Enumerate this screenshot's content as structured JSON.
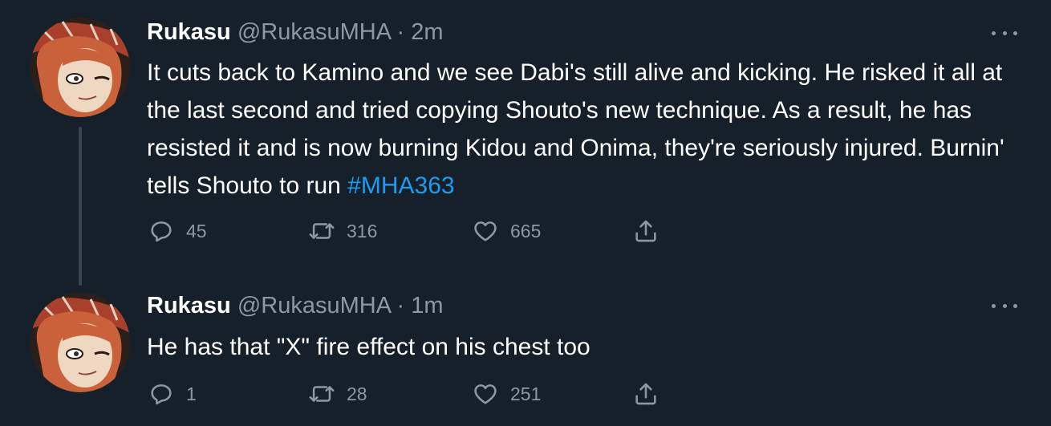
{
  "tweets": [
    {
      "display_name": "Rukasu",
      "handle": "@RukasuMHA",
      "separator": "·",
      "time": "2m",
      "text": "It cuts back to Kamino and we see Dabi's still alive and kicking. He risked it all at the last second and tried copying Shouto's new technique. As a result, he has resisted it and is now burning Kidou and Onima, they're seriously injured. Burnin' tells Shouto to run ",
      "hashtag": "#MHA363",
      "replies": "45",
      "retweets": "316",
      "likes": "665"
    },
    {
      "display_name": "Rukasu",
      "handle": "@RukasuMHA",
      "separator": "·",
      "time": "1m",
      "text": "He has that \"X\" fire effect on his chest too",
      "hashtag": "",
      "replies": "1",
      "retweets": "28",
      "likes": "251"
    }
  ],
  "colors": {
    "background": "#15202b",
    "text": "#ffffff",
    "secondary": "#8b98a5",
    "link": "#1d9bf0",
    "thread_line": "#38444d"
  },
  "icons": [
    "reply-icon",
    "retweet-icon",
    "like-icon",
    "share-icon",
    "more-icon"
  ]
}
